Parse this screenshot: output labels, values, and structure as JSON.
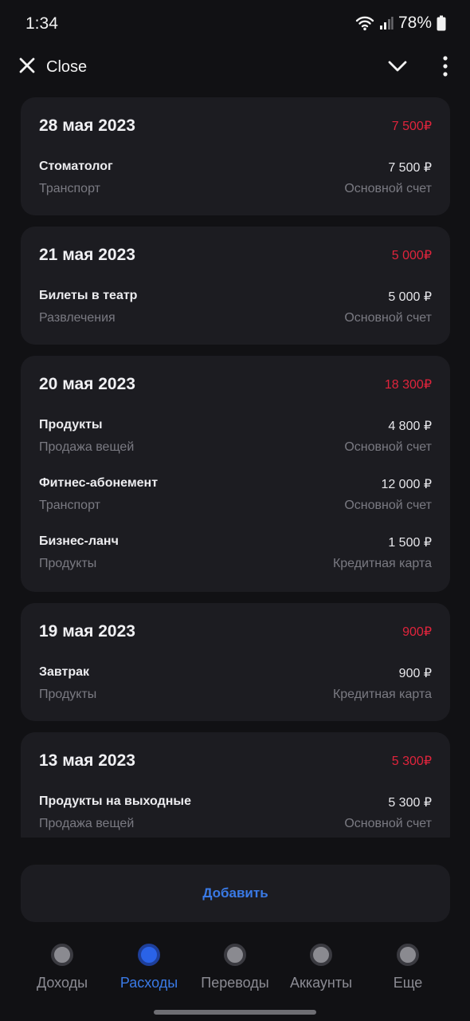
{
  "status": {
    "time": "1:34",
    "battery": "78%"
  },
  "header": {
    "close_label": "Close"
  },
  "groups": [
    {
      "date": "28 мая 2023",
      "total": "7 500₽",
      "items": [
        {
          "name": "Стоматолог",
          "amount": "7 500 ₽",
          "category": "Транспорт",
          "account": "Основной счет"
        }
      ]
    },
    {
      "date": "21 мая 2023",
      "total": "5 000₽",
      "items": [
        {
          "name": "Билеты в театр",
          "amount": "5 000 ₽",
          "category": "Развлечения",
          "account": "Основной счет"
        }
      ]
    },
    {
      "date": "20 мая 2023",
      "total": "18 300₽",
      "items": [
        {
          "name": "Продукты",
          "amount": "4 800 ₽",
          "category": "Продажа вещей",
          "account": "Основной счет"
        },
        {
          "name": "Фитнес-абонемент",
          "amount": "12 000 ₽",
          "category": "Транспорт",
          "account": "Основной счет"
        },
        {
          "name": "Бизнес-ланч",
          "amount": "1 500 ₽",
          "category": "Продукты",
          "account": "Кредитная карта"
        }
      ]
    },
    {
      "date": "19 мая 2023",
      "total": "900₽",
      "items": [
        {
          "name": "Завтрак",
          "amount": "900 ₽",
          "category": "Продукты",
          "account": "Кредитная карта"
        }
      ]
    },
    {
      "date": "13 мая 2023",
      "total": "5 300₽",
      "items": [
        {
          "name": "Продукты на выходные",
          "amount": "5 300 ₽",
          "category": "Продажа вещей",
          "account": "Основной счет"
        }
      ]
    }
  ],
  "add_button": {
    "label": "Добавить"
  },
  "tabs": [
    {
      "label": "Доходы",
      "active": false
    },
    {
      "label": "Расходы",
      "active": true
    },
    {
      "label": "Переводы",
      "active": false
    },
    {
      "label": "Аккаунты",
      "active": false
    },
    {
      "label": "Еще",
      "active": false
    }
  ],
  "colors": {
    "accent": "#3a7ae6",
    "expense": "#e0243c",
    "card": "#1c1c21",
    "background": "#111114"
  }
}
